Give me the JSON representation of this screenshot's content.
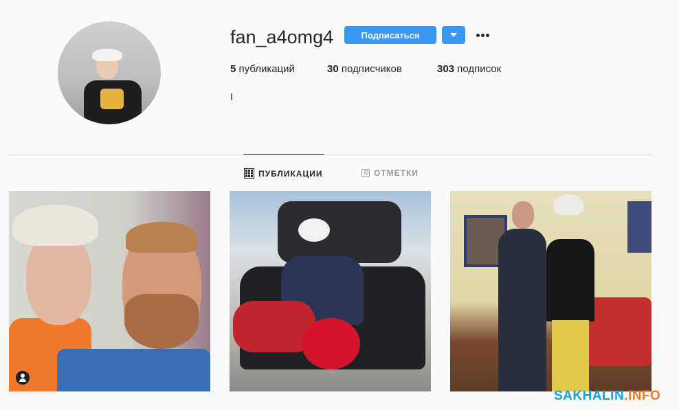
{
  "profile": {
    "username": "fan_a4omg4",
    "subscribe_label": "Подписаться",
    "stats": [
      {
        "count": "5",
        "label": "публикаций"
      },
      {
        "count": "30",
        "label": "подписчиков"
      },
      {
        "count": "303",
        "label": "подписок"
      }
    ],
    "bio": "I"
  },
  "tabs": {
    "publications": "ПУБЛИКАЦИИ",
    "tagged": "ОТМЕТКИ"
  },
  "icons": {
    "dropdown": "chevron-down-icon",
    "more": "more-horizontal-icon",
    "grid": "grid-icon",
    "tagged": "tagged-user-icon",
    "user_badge": "user-tag-icon"
  },
  "colors": {
    "accent": "#3897f0",
    "text": "#262626",
    "muted": "#999999",
    "watermark_primary": "#1aa0d8",
    "watermark_secondary": "#f07b22"
  },
  "watermark": {
    "part1": "SAKHALIN",
    "part2": ".INFO"
  }
}
